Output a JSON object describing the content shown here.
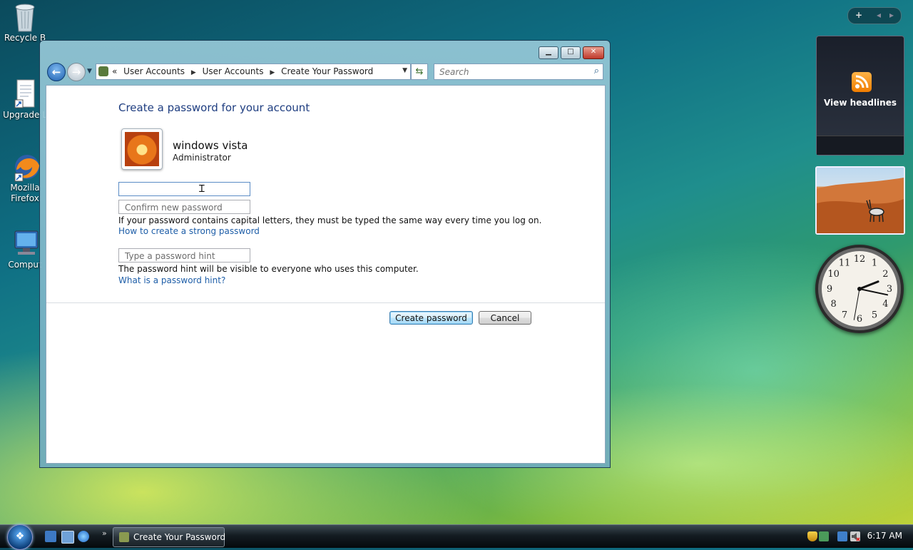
{
  "desktop": {
    "icons": [
      {
        "label": "Recycle B",
        "name": "recycle-bin"
      },
      {
        "label": "Upgrade L",
        "name": "upgrade"
      },
      {
        "label": "Mozilla Firefox",
        "line1": "Mozilla",
        "line2": "Firefox",
        "name": "firefox"
      },
      {
        "label": "Comput",
        "name": "computer"
      }
    ]
  },
  "sidebar": {
    "rss_label": "View headlines",
    "clock_numbers": [
      "12",
      "1",
      "2",
      "3",
      "4",
      "5",
      "6",
      "7",
      "8",
      "9",
      "10",
      "11"
    ],
    "clock_time": {
      "hour": 2,
      "minute": 17
    }
  },
  "window": {
    "title": "Create Your Password",
    "breadcrumb": [
      "User Accounts",
      "User Accounts",
      "Create Your Password"
    ],
    "breadcrumb_lead": "«",
    "search_placeholder": "Search",
    "page_title": "Create a password for your account",
    "user": {
      "name": "windows vista",
      "role": "Administrator"
    },
    "fields": {
      "new_password": {
        "value": "",
        "placeholder": ""
      },
      "confirm_placeholder": "Confirm new password",
      "hint_placeholder": "Type a password hint"
    },
    "caps_note": "If your password contains capital letters, they must be typed the same way every time you log on.",
    "strong_link": "How to create a strong password",
    "hint_note": "The password hint will be visible to everyone who uses this computer.",
    "hint_link": "What is a password hint?",
    "create_button": "Create password",
    "cancel_button": "Cancel"
  },
  "taskbar": {
    "task_label": "Create Your Password",
    "time": "6:17 AM"
  },
  "colors": {
    "link": "#1e5ea8",
    "title": "#1e3d80",
    "primary_button_border": "#3c7fb1"
  }
}
